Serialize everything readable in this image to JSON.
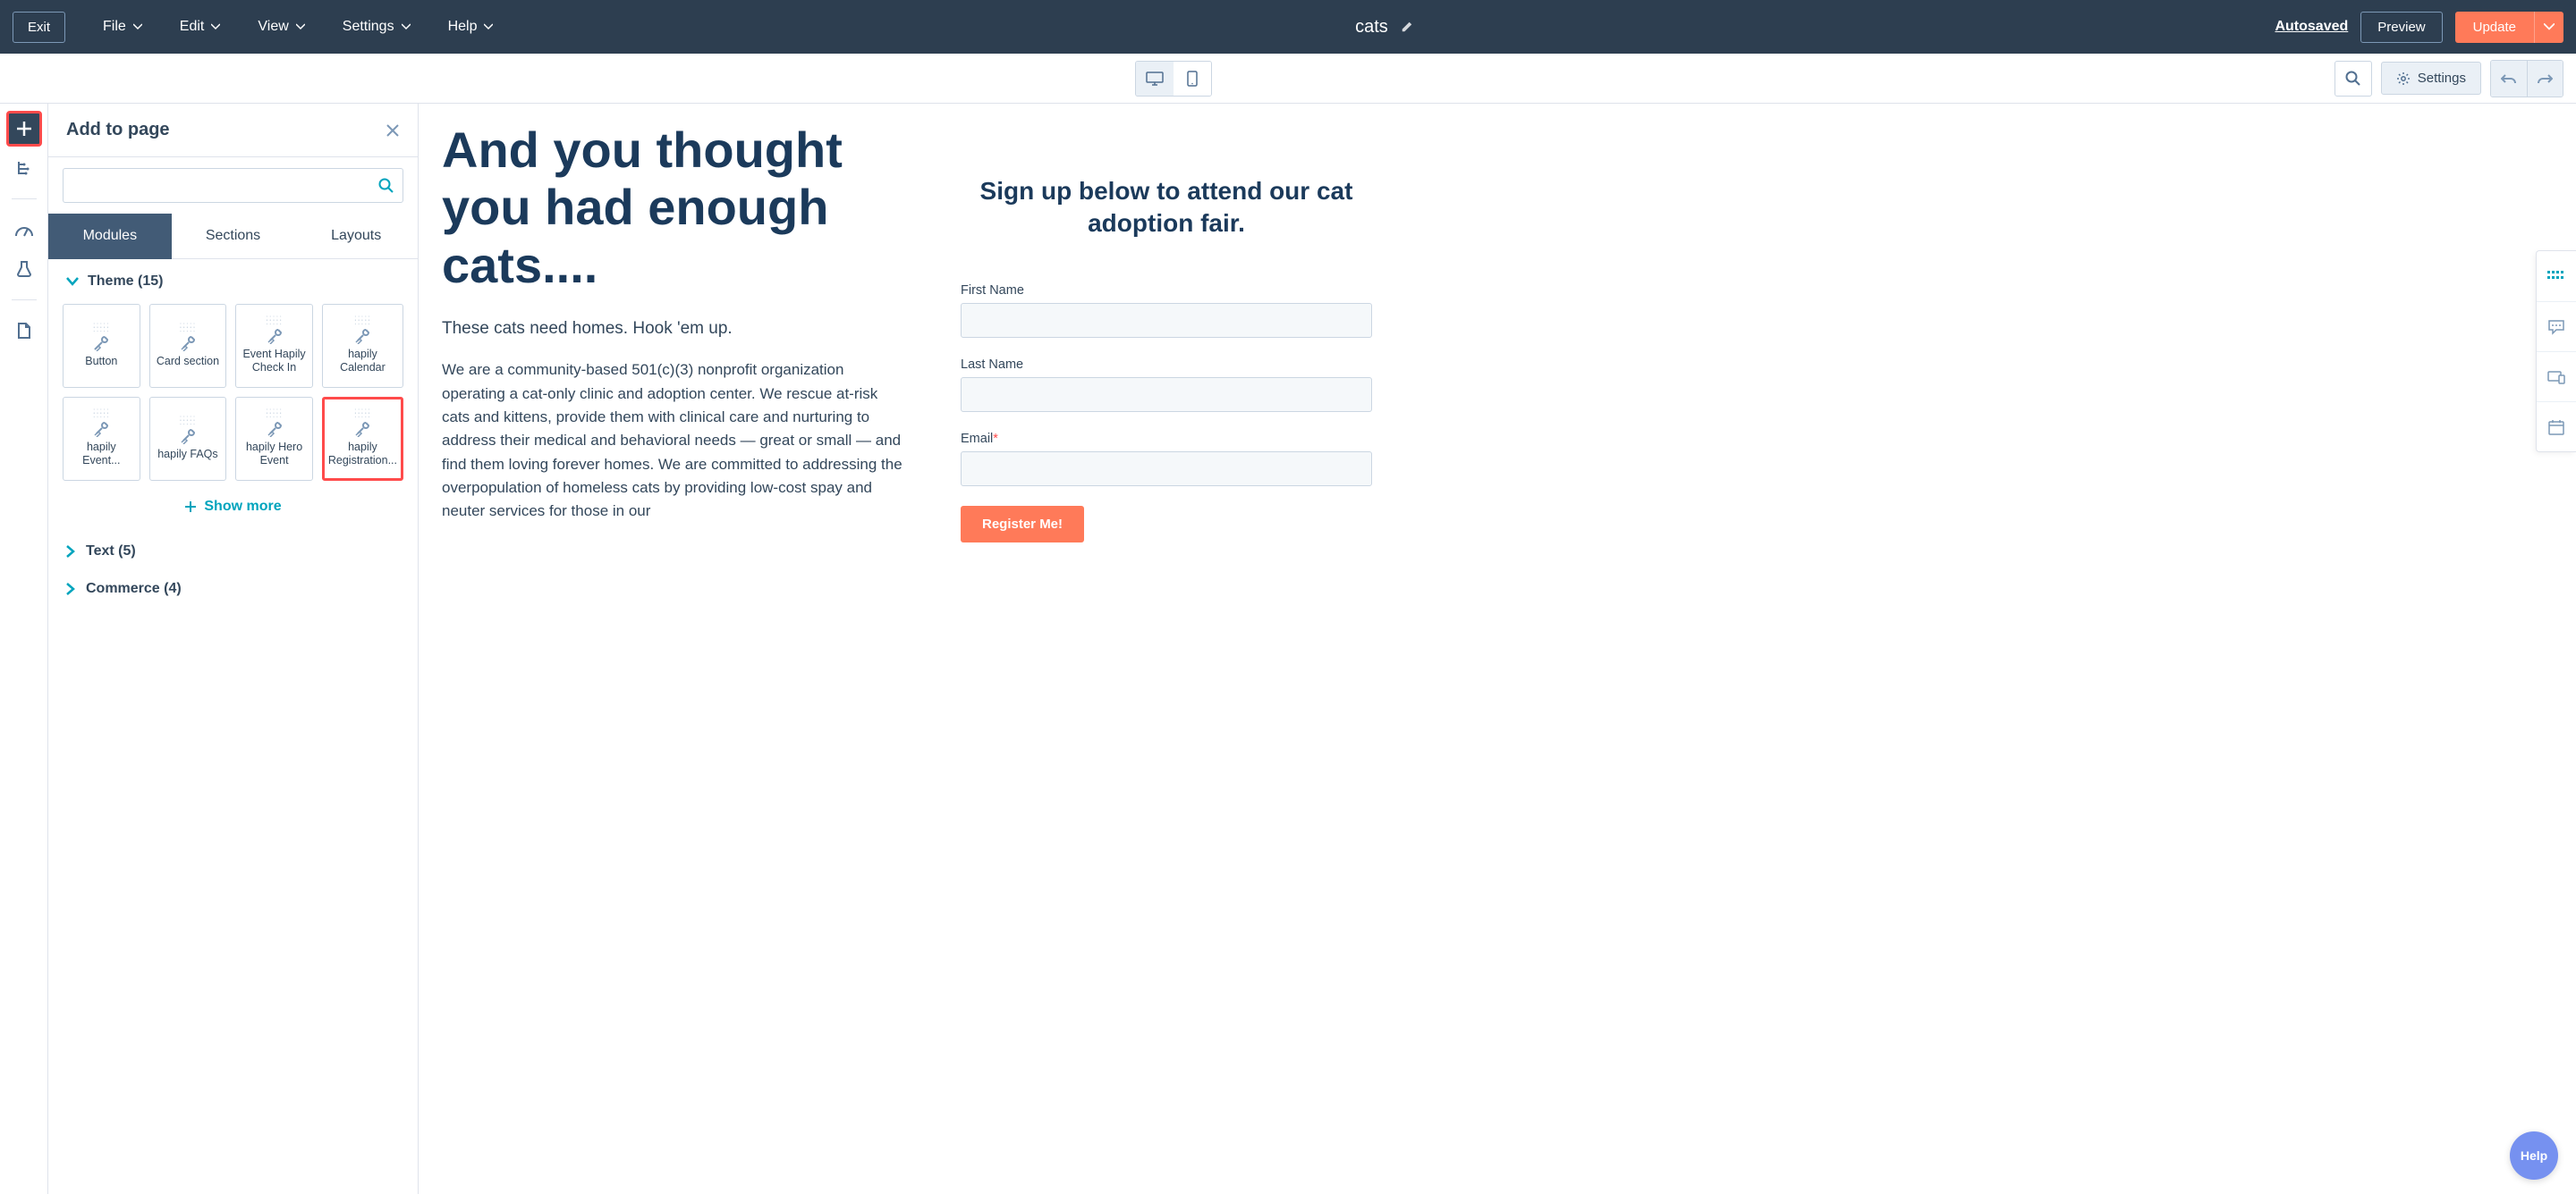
{
  "topbar": {
    "exit": "Exit",
    "menu": [
      "File",
      "Edit",
      "View",
      "Settings",
      "Help"
    ],
    "page_title": "cats",
    "autosaved": "Autosaved",
    "preview": "Preview",
    "update": "Update"
  },
  "toolbar": {
    "settings": "Settings"
  },
  "sidebar": {
    "title": "Add to page",
    "search_placeholder": "",
    "tabs": [
      "Modules",
      "Sections",
      "Layouts"
    ],
    "theme_section": "Theme (15)",
    "modules": [
      "Button",
      "Card section",
      "Event Hapily Check In",
      "hapily Calendar",
      "hapily Event...",
      "hapily FAQs",
      "hapily Hero Event",
      "hapily Registration..."
    ],
    "show_more": "Show more",
    "collapsed": [
      "Text (5)",
      "Commerce (4)"
    ]
  },
  "canvas": {
    "headline": "And you thought you had enough cats....",
    "subhead": "These cats need homes. Hook 'em up.",
    "body": "We are a community-based 501(c)(3) nonprofit organization operating a cat-only clinic and adoption center. We rescue at-risk cats and kittens, provide them with clinical care and nurturing to address their medical and behavioral needs — great or small — and find them loving forever homes. We are committed to addressing the overpopulation of homeless cats by providing low-cost spay and neuter services for those in our",
    "form_title": "Sign up below to attend our cat adoption fair.",
    "first_name_label": "First Name",
    "last_name_label": "Last Name",
    "email_label": "Email",
    "register": "Register Me!"
  },
  "help": "Help"
}
